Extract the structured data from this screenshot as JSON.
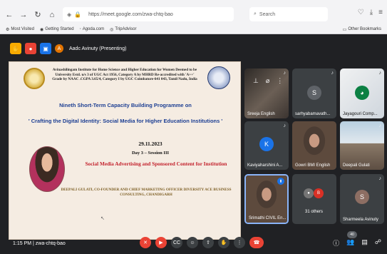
{
  "browser": {
    "url": "https://meet.google.com/zwa-chtq-bao",
    "search_placeholder": "Search",
    "bookmarks": [
      "Most Visited",
      "Getting Started",
      "Agoda.com",
      "TripAdvisor"
    ],
    "other_bookmarks": "Other Bookmarks"
  },
  "meet": {
    "presenter": "Aadc Avinuty (Presenting)",
    "time": "1:15 PM",
    "meeting_code": "zwa-chtq-bao",
    "participant_count": "40",
    "slide": {
      "institution": "Avinashilingam Institute for Home Science and Higher Education for Women Deemed to be University Estd. u/s 3 of UGC Act 1956, Category A by MHRD Re-accredited with 'A++' Grade by NAAC .CGPA 3.65/4, Category I by UGC Coimbatore-641 043, Tamil Nadu, India",
      "programme": "Nineth Short-Term Capacity Building Programme on",
      "theme": "' Crafting the Digital Identity: Social Media for Higher Education Institutions '",
      "date": "29.11.2023",
      "session": "Day 3 – Session III",
      "topic": "Social Media Advertising and Sponsored Content for Institution",
      "speaker": "DEEPALI GULATI, CO-FOUNDER AND CHIEF MARKETING OFFICER DIVERSITY ACE BUSINESS CONSULTING, CHANDIGARH"
    },
    "participants": [
      {
        "name": "Sreeja English",
        "avatar": "",
        "color": ""
      },
      {
        "name": "sarhyabamavath...",
        "avatar": "S",
        "color": "#5f6368"
      },
      {
        "name": "Jayagouri Comp...",
        "avatar": "",
        "color": ""
      },
      {
        "name": "Kaviyaharshini A...",
        "avatar": "K",
        "color": "#1a73e8"
      },
      {
        "name": "Gowri BMI English",
        "avatar": "",
        "color": ""
      },
      {
        "name": "Deepali Gulati",
        "avatar": "",
        "color": ""
      },
      {
        "name": "Srimathi CIVIL En...",
        "avatar": "",
        "color": ""
      },
      {
        "name": "31 others",
        "avatar": "B",
        "color": "#d93025"
      },
      {
        "name": "Sharmeela Avinuty",
        "avatar": "S",
        "color": "#8d6e63"
      }
    ]
  }
}
